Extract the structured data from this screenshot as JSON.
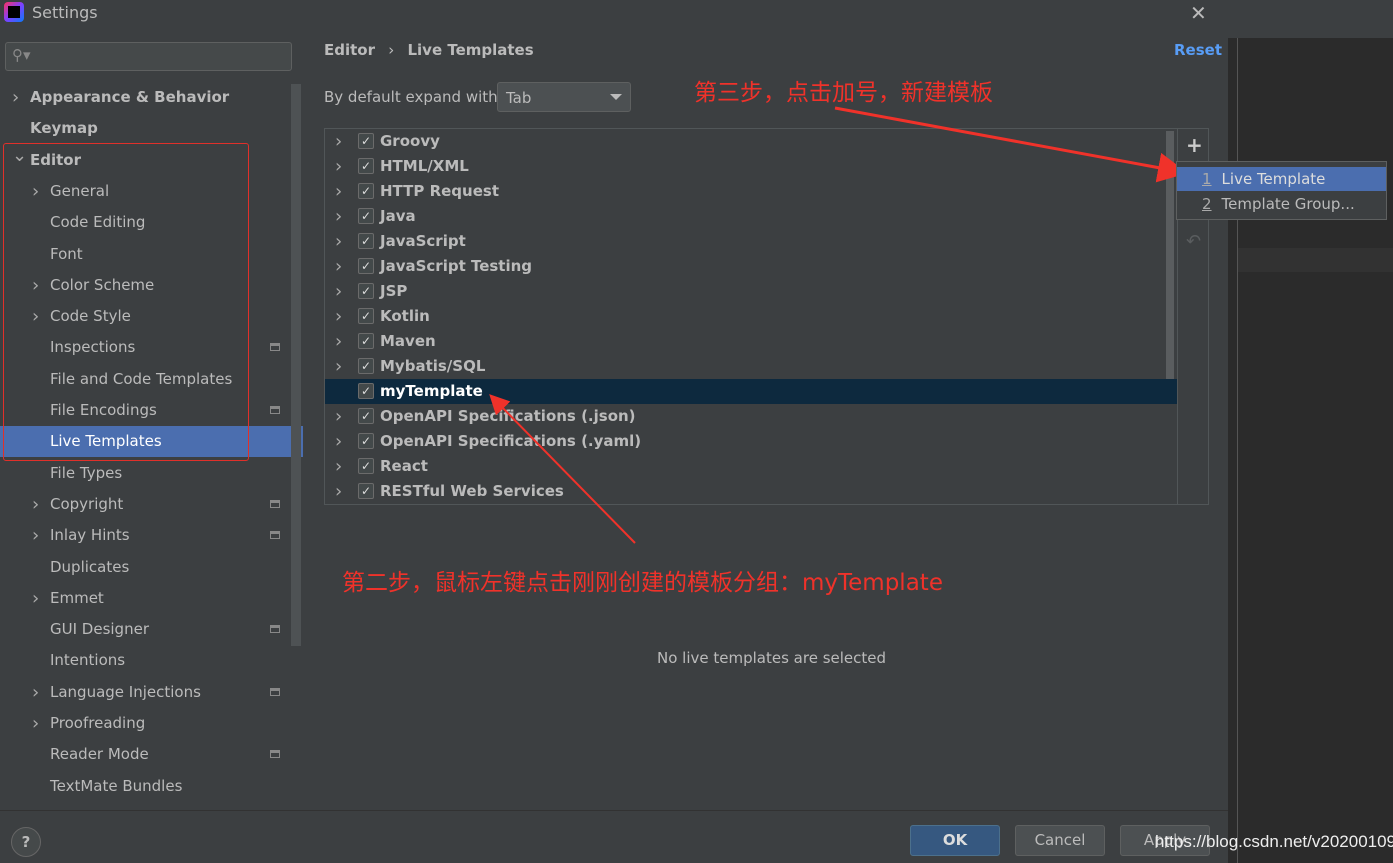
{
  "window": {
    "title": "Settings",
    "close": "✕"
  },
  "search": {
    "icon": "search-icon",
    "glyph": "⚲▾"
  },
  "sidebar": {
    "items": [
      {
        "label": "Appearance & Behavior",
        "level": 0,
        "chevron": "right",
        "bold": true
      },
      {
        "label": "Keymap",
        "level": 0,
        "bold": true
      },
      {
        "label": "Editor",
        "level": 0,
        "chevron": "down",
        "bold": true
      },
      {
        "label": "General",
        "level": 1,
        "chevron": "right"
      },
      {
        "label": "Code Editing",
        "level": 1
      },
      {
        "label": "Font",
        "level": 1
      },
      {
        "label": "Color Scheme",
        "level": 1,
        "chevron": "right"
      },
      {
        "label": "Code Style",
        "level": 1,
        "chevron": "right"
      },
      {
        "label": "Inspections",
        "level": 1,
        "page_icon": true
      },
      {
        "label": "File and Code Templates",
        "level": 1
      },
      {
        "label": "File Encodings",
        "level": 1,
        "page_icon": true
      },
      {
        "label": "Live Templates",
        "level": 1,
        "selected": true
      },
      {
        "label": "File Types",
        "level": 1
      },
      {
        "label": "Copyright",
        "level": 1,
        "chevron": "right",
        "page_icon": true
      },
      {
        "label": "Inlay Hints",
        "level": 1,
        "chevron": "right",
        "page_icon": true
      },
      {
        "label": "Duplicates",
        "level": 1
      },
      {
        "label": "Emmet",
        "level": 1,
        "chevron": "right"
      },
      {
        "label": "GUI Designer",
        "level": 1,
        "page_icon": true
      },
      {
        "label": "Intentions",
        "level": 1
      },
      {
        "label": "Language Injections",
        "level": 1,
        "chevron": "right",
        "page_icon": true
      },
      {
        "label": "Proofreading",
        "level": 1,
        "chevron": "right"
      },
      {
        "label": "Reader Mode",
        "level": 1,
        "page_icon": true
      },
      {
        "label": "TextMate Bundles",
        "level": 1
      }
    ]
  },
  "main": {
    "breadcrumb": {
      "parent": "Editor",
      "sep": "›",
      "current": "Live Templates"
    },
    "reset": "Reset",
    "expand_label": "By default expand with",
    "expand_value": "Tab",
    "groups": [
      {
        "label": "Groovy",
        "checked": true
      },
      {
        "label": "HTML/XML",
        "checked": true
      },
      {
        "label": "HTTP Request",
        "checked": true
      },
      {
        "label": "Java",
        "checked": true
      },
      {
        "label": "JavaScript",
        "checked": true
      },
      {
        "label": "JavaScript Testing",
        "checked": true
      },
      {
        "label": "JSP",
        "checked": true
      },
      {
        "label": "Kotlin",
        "checked": true
      },
      {
        "label": "Maven",
        "checked": true
      },
      {
        "label": "Mybatis/SQL",
        "checked": true
      },
      {
        "label": "myTemplate",
        "checked": true,
        "selected": true,
        "no_chevron": true
      },
      {
        "label": "OpenAPI Specifications (.json)",
        "checked": true
      },
      {
        "label": "OpenAPI Specifications (.yaml)",
        "checked": true
      },
      {
        "label": "React",
        "checked": true
      },
      {
        "label": "RESTful Web Services",
        "checked": true
      }
    ],
    "toolbar": {
      "add": "+",
      "undo": "↶"
    },
    "popup": [
      {
        "num": "1",
        "label": "Live Template",
        "selected": true
      },
      {
        "num": "2",
        "label": "Template Group..."
      }
    ],
    "empty_message": "No live templates are selected"
  },
  "annotations": {
    "step3": "第三步，点击加号，新建模板",
    "step2": "第二步，鼠标左键点击刚刚创建的模板分组：myTemplate",
    "color": "#f0322a"
  },
  "footer": {
    "help": "?",
    "ok": "OK",
    "cancel": "Cancel",
    "apply": "Apply"
  },
  "watermark": "https://blog.csdn.net/v20200109"
}
